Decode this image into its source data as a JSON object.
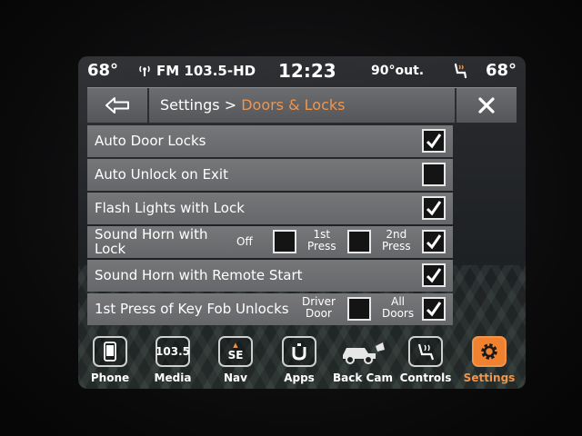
{
  "status": {
    "left_temp": "68°",
    "radio": "FM 103.5-HD",
    "clock": "12:23",
    "outside": "90°out.",
    "right_temp": "68°"
  },
  "breadcrumb": {
    "parent": "Settings > ",
    "current": "Doors & Locks"
  },
  "settings": [
    {
      "label": "Auto Door Locks",
      "checked": true
    },
    {
      "label": "Auto Unlock on Exit",
      "checked": false
    },
    {
      "label": "Flash Lights with Lock",
      "checked": true
    },
    {
      "label_line1": "Sound Horn with",
      "label_line2": "Lock",
      "options": [
        {
          "label": "Off",
          "checked": false
        },
        {
          "label_line1": "1st",
          "label_line2": "Press",
          "checked": false
        },
        {
          "label_line1": "2nd",
          "label_line2": "Press",
          "checked": true
        }
      ]
    },
    {
      "label": "Sound Horn with Remote Start",
      "checked": true
    },
    {
      "label": "1st Press of Key Fob Unlocks",
      "options": [
        {
          "label_line1": "Driver",
          "label_line2": "Door",
          "checked": false
        },
        {
          "label_line1": "All",
          "label_line2": "Doors",
          "checked": true
        }
      ]
    }
  ],
  "dock": [
    {
      "label": "Phone",
      "icon": "phone-icon"
    },
    {
      "label": "Media",
      "icon_text": "103.5"
    },
    {
      "label": "Nav",
      "icon_text": "SE"
    },
    {
      "label": "Apps",
      "icon": "apps-icon"
    },
    {
      "label": "Back Cam",
      "icon": "back-cam-icon"
    },
    {
      "label": "Controls",
      "icon": "controls-icon"
    },
    {
      "label": "Settings",
      "icon": "gear-icon",
      "active": true
    }
  ],
  "colors": {
    "accent": "#f2954a",
    "row": "#707174",
    "title_bar": "#606164"
  }
}
